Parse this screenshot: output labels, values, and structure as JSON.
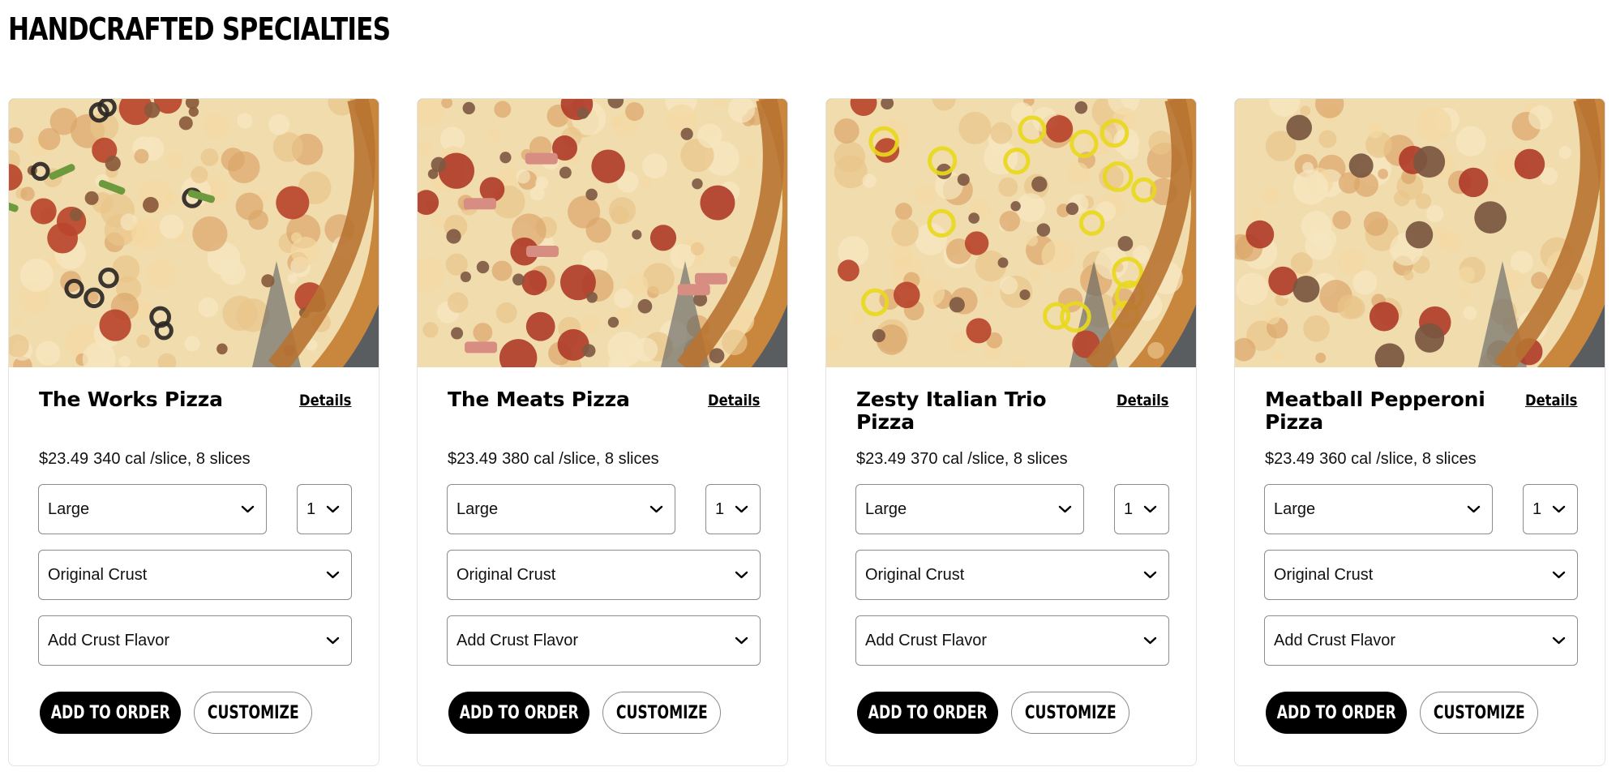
{
  "section": {
    "title": "HANDCRAFTED SPECIALTIES"
  },
  "labels": {
    "details": "Details",
    "add_to_order": "ADD TO ORDER",
    "customize": "CUSTOMIZE"
  },
  "cards": [
    {
      "name": "The Works Pizza",
      "price": "$23.49",
      "nutrition": "340 cal /slice, 8 slices",
      "size": "Large",
      "qty": "1",
      "crust": "Original Crust",
      "flavor": "Add Crust Flavor",
      "toppings": "works"
    },
    {
      "name": "The Meats Pizza",
      "price": "$23.49",
      "nutrition": "380 cal /slice, 8 slices",
      "size": "Large",
      "qty": "1",
      "crust": "Original Crust",
      "flavor": "Add Crust Flavor",
      "toppings": "meats"
    },
    {
      "name": "Zesty Italian Trio Pizza",
      "price": "$23.49",
      "nutrition": "370 cal /slice, 8 slices",
      "size": "Large",
      "qty": "1",
      "crust": "Original Crust",
      "flavor": "Add Crust Flavor",
      "toppings": "zesty"
    },
    {
      "name": "Meatball Pepperoni Pizza",
      "price": "$23.49",
      "nutrition": "360 cal /slice, 8 slices",
      "size": "Large",
      "qty": "1",
      "crust": "Original Crust",
      "flavor": "Add Crust Flavor",
      "toppings": "meatball"
    }
  ],
  "colors": {
    "button_primary": "#000000",
    "border": "#8c8c8c",
    "card_border": "#e3e3e3"
  }
}
